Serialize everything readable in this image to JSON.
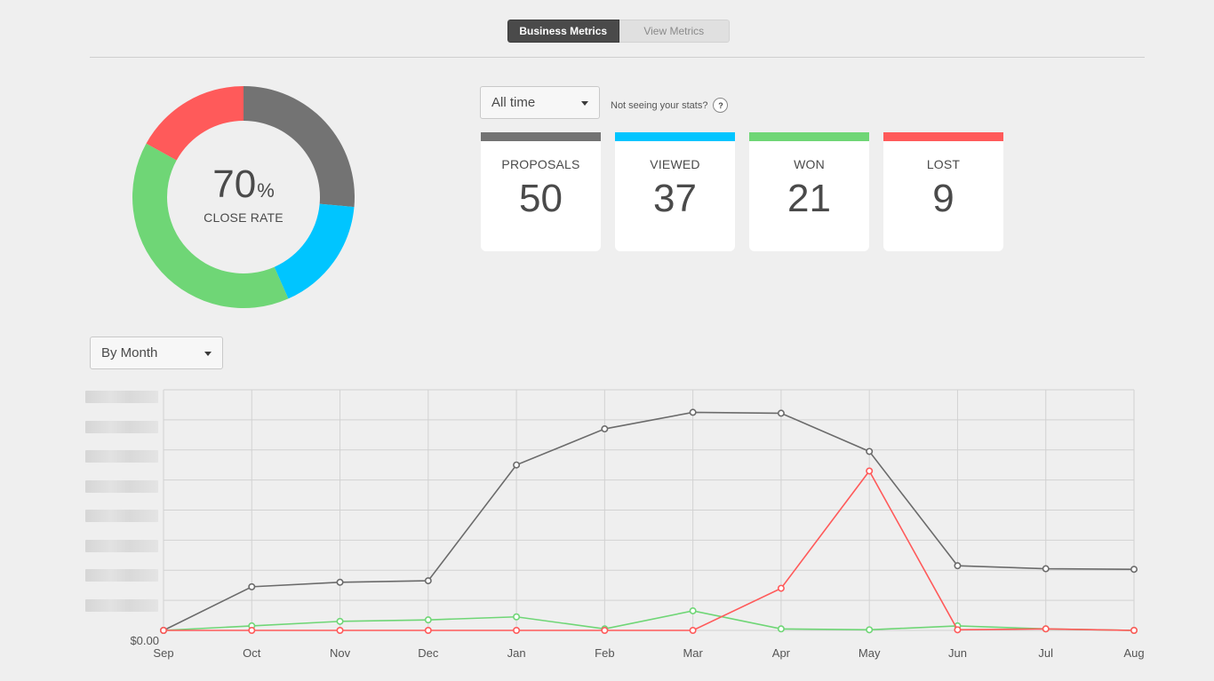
{
  "tabs": {
    "business_label": "Business Metrics",
    "view_label": "View Metrics"
  },
  "donut": {
    "rate_value": "70",
    "rate_unit": "%",
    "rate_label": "CLOSE RATE",
    "segments": [
      {
        "name": "proposals",
        "value": 14,
        "color": "#737373"
      },
      {
        "name": "viewed",
        "value": 9,
        "color": "#00c5ff"
      },
      {
        "name": "won",
        "value": 21,
        "color": "#6fd676"
      },
      {
        "name": "lost",
        "value": 9,
        "color": "#ff5a5a"
      }
    ]
  },
  "filters": {
    "time_range": "All time",
    "stats_hint": "Not seeing your stats?",
    "help_icon_text": "?",
    "grouping": "By Month"
  },
  "stats": [
    {
      "label": "PROPOSALS",
      "value": "50",
      "color": "#737373"
    },
    {
      "label": "VIEWED",
      "value": "37",
      "color": "#00c5ff"
    },
    {
      "label": "WON",
      "value": "21",
      "color": "#6fd676"
    },
    {
      "label": "LOST",
      "value": "9",
      "color": "#ff5a5a"
    }
  ],
  "chart_data": {
    "type": "line",
    "categories": [
      "Sep",
      "Oct",
      "Nov",
      "Dec",
      "Jan",
      "Feb",
      "Mar",
      "Apr",
      "May",
      "Jun",
      "Jul",
      "Aug"
    ],
    "y_axis_first_label": "$0.00",
    "ylim": [
      0,
      8
    ],
    "grid": true,
    "series": [
      {
        "color": "#6b6b6b",
        "values": [
          0,
          1.45,
          1.6,
          1.65,
          5.5,
          6.7,
          7.25,
          7.22,
          5.95,
          2.15,
          2.05,
          2.03
        ]
      },
      {
        "color": "#6fd676",
        "values": [
          0,
          0.15,
          0.3,
          0.35,
          0.45,
          0.05,
          0.65,
          0.05,
          0.02,
          0.15,
          0.05,
          0.0
        ]
      },
      {
        "color": "#ff5a5a",
        "values": [
          0,
          0,
          0,
          0,
          0,
          0,
          0,
          1.4,
          5.3,
          0.02,
          0.05,
          0.0
        ]
      }
    ]
  }
}
